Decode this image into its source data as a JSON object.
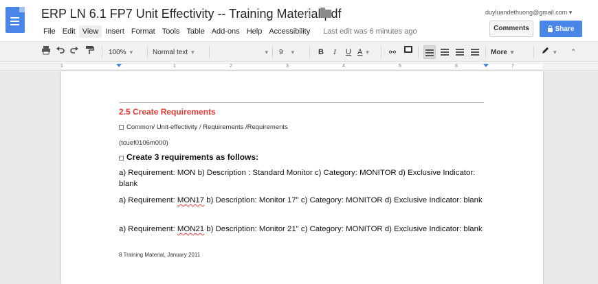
{
  "header": {
    "title": "ERP LN 6.1 FP7 Unit Effectivity -- Training Material.pdf",
    "user_email": "duyluandethuong@gmail.com",
    "comments_label": "Comments",
    "share_label": "Share",
    "last_edit": "Last edit was 6 minutes ago",
    "menu": [
      "File",
      "Edit",
      "View",
      "Insert",
      "Format",
      "Tools",
      "Table",
      "Add-ons",
      "Help",
      "Accessibility"
    ]
  },
  "toolbar": {
    "zoom": "100%",
    "style": "Normal text",
    "font_size": "9",
    "bold": "B",
    "italic": "I",
    "underline": "U",
    "text_color": "A",
    "more": "More"
  },
  "ruler": {
    "numbers": [
      "1",
      "1",
      "2",
      "3",
      "4",
      "5",
      "6",
      "7"
    ]
  },
  "document": {
    "heading": "2.5 Create Requirements",
    "path": "Common/ Unit-effectivity / Requirements /Requirements",
    "session": "(tcuef0106m000)",
    "bold_item": "Create 3 requirements as follows:",
    "para1": "a) Requirement: MON b) Description : Standard Monitor c) Category: MONITOR d) Exclusive Indicator: blank",
    "para2_pre": "a) Requirement: ",
    "para2_code": "MON17",
    "para2_post": " b) Description: Monitor 17\" c) Category: MONITOR d) Exclusive Indicator: blank",
    "para3_pre": "a) Requirement: ",
    "para3_code": "MON21",
    "para3_post": " b) Description: Monitor 21\" c) Category: MONITOR d) Exclusive Indicator: blank",
    "footer": "8 Training Material, January 2011"
  }
}
